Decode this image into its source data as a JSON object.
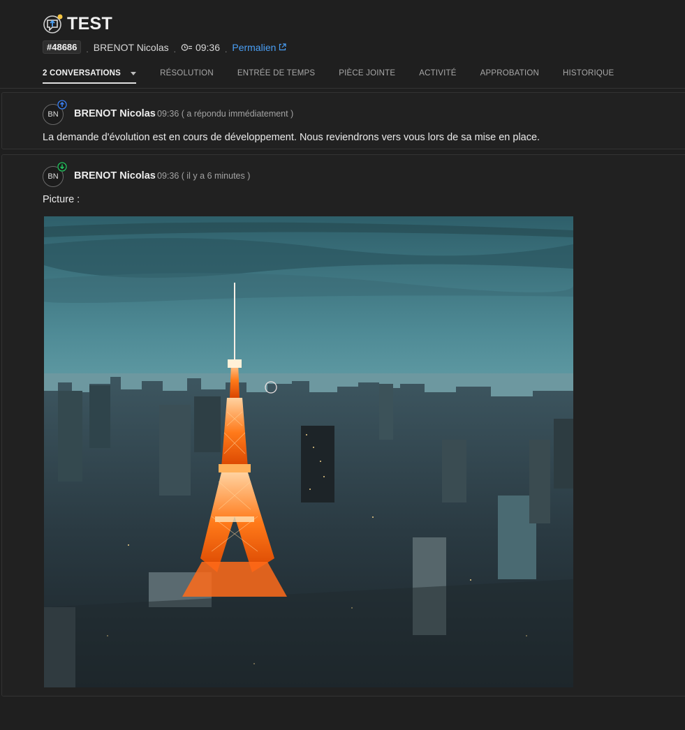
{
  "header": {
    "title": "TEST",
    "ticket_id": "#48686",
    "author": "BRENOT Nicolas",
    "time": "09:36",
    "permalink": "Permalien"
  },
  "tabs": [
    {
      "label": "2 CONVERSATIONS",
      "active": true
    },
    {
      "label": "RÉSOLUTION"
    },
    {
      "label": "ENTRÉE DE TEMPS"
    },
    {
      "label": "PIÈCE JOINTE"
    },
    {
      "label": "ACTIVITÉ"
    },
    {
      "label": "APPROBATION"
    },
    {
      "label": "HISTORIQUE"
    }
  ],
  "conversations": [
    {
      "avatar": "BN",
      "badge_icon": "arrow-up-icon",
      "badge_color": "#3b82f6",
      "author": "BRENOT Nicolas",
      "time": "09:36 ( a répondu immédiatement )",
      "message": "La demande d'évolution est en cours de développement. Nous reviendrons vers vous lors de sa mise en place."
    },
    {
      "avatar": "BN",
      "badge_icon": "arrow-down-icon",
      "badge_color": "#22c55e",
      "author": "BRENOT Nicolas",
      "time": "09:36 ( il y a 6 minutes )",
      "message": "Picture :",
      "attachment_icon": "photo-tokyo-tower"
    }
  ],
  "colors": {
    "background": "#1f1f1f",
    "link": "#4a9ff5",
    "icon_badge": "#f5c542"
  }
}
